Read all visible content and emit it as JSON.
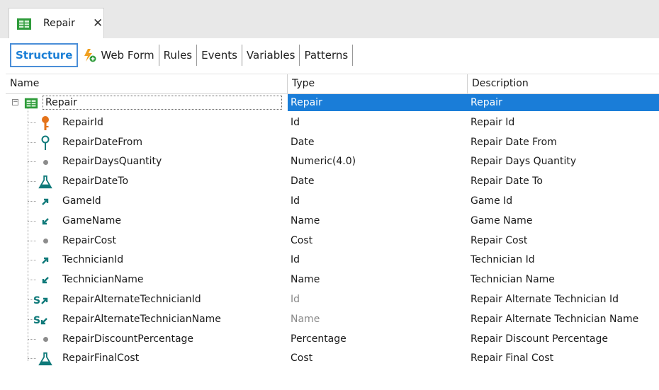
{
  "tab": {
    "label": "Repair",
    "close_glyph": "✕"
  },
  "subtabs": [
    "Structure",
    "Web Form",
    "Rules",
    "Events",
    "Variables",
    "Patterns"
  ],
  "columns": {
    "name": "Name",
    "type": "Type",
    "description": "Description"
  },
  "root": {
    "name": "Repair",
    "type": "Repair",
    "description": "Repair",
    "icon": "transaction-icon",
    "expander": "−"
  },
  "rows": [
    {
      "name": "RepairId",
      "type": "Id",
      "description": "Repair Id",
      "icon": "primary-key-icon"
    },
    {
      "name": "RepairDateFrom",
      "type": "Date",
      "description": "Repair Date From",
      "icon": "candidate-key-icon"
    },
    {
      "name": "RepairDaysQuantity",
      "type": "Numeric(4.0)",
      "description": "Repair Days Quantity",
      "icon": "attribute-dot-icon"
    },
    {
      "name": "RepairDateTo",
      "type": "Date",
      "description": "Repair Date To",
      "icon": "formula-flask-icon"
    },
    {
      "name": "GameId",
      "type": "Id",
      "description": "Game Id",
      "icon": "foreign-key-icon"
    },
    {
      "name": "GameName",
      "type": "Name",
      "description": "Game Name",
      "icon": "inferred-attribute-icon"
    },
    {
      "name": "RepairCost",
      "type": "Cost",
      "description": "Repair Cost",
      "icon": "attribute-dot-icon"
    },
    {
      "name": "TechnicianId",
      "type": "Id",
      "description": "Technician Id",
      "icon": "foreign-key-icon"
    },
    {
      "name": "TechnicianName",
      "type": "Name",
      "description": "Technician Name",
      "icon": "inferred-attribute-icon"
    },
    {
      "name": "RepairAlternateTechnicianId",
      "type": "Id",
      "description": "Repair Alternate Technician Id",
      "icon": "subtype-foreign-key-icon",
      "type_gray": true
    },
    {
      "name": "RepairAlternateTechnicianName",
      "type": "Name",
      "description": "Repair Alternate Technician Name",
      "icon": "subtype-inferred-icon",
      "type_gray": true
    },
    {
      "name": "RepairDiscountPercentage",
      "type": "Percentage",
      "description": "Repair Discount Percentage",
      "icon": "attribute-dot-icon"
    },
    {
      "name": "RepairFinalCost",
      "type": "Cost",
      "description": "Repair Final Cost",
      "icon": "formula-flask-icon"
    }
  ],
  "colors": {
    "accent": "#1a7dd8",
    "structure_tab": "#1b7fd6",
    "teal": "#0f7a7a",
    "key_orange": "#e4731a"
  }
}
